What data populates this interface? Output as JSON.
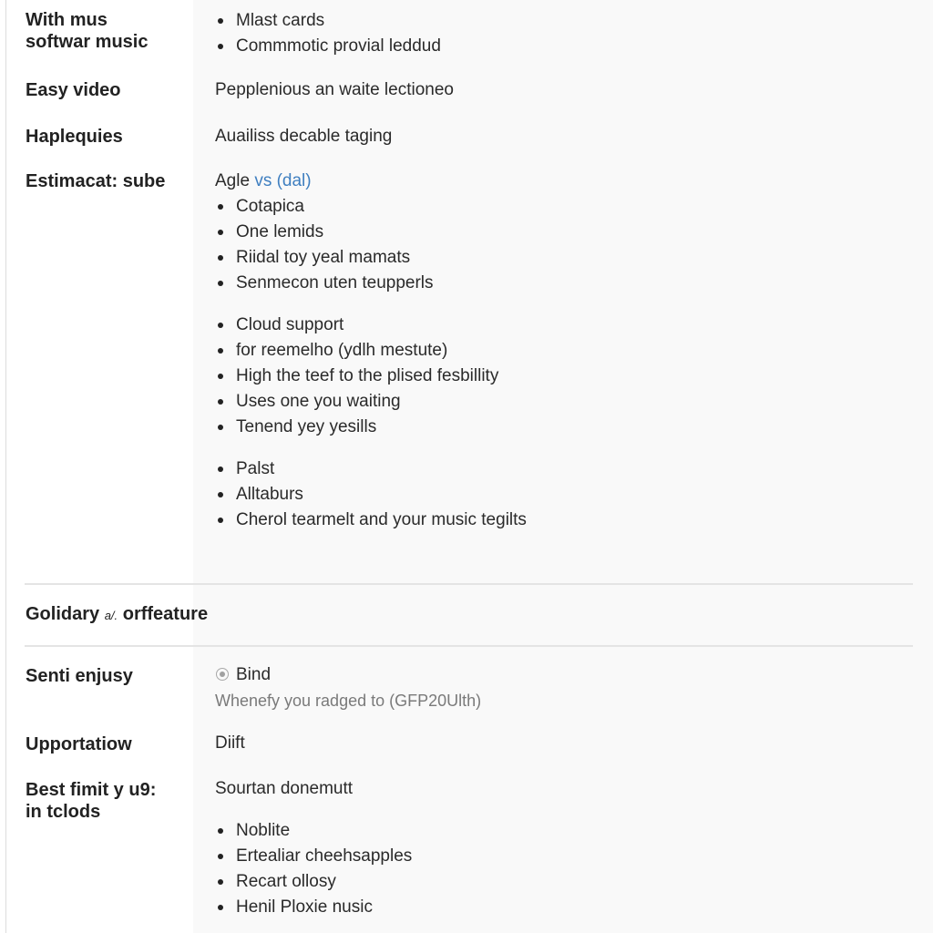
{
  "rows": [
    {
      "label": "With mus softwar music",
      "bullets": [
        "Mlast cards",
        "Commmotic provial leddud"
      ]
    },
    {
      "label": "Easy video",
      "value": "Pepplenious an waite lectioneo"
    },
    {
      "label": "Haplequies",
      "value": "Auailiss decable taging"
    },
    {
      "label": "Estimacat: sube",
      "value_prefix": "Agle",
      "value_link": "vs (dal)",
      "bullets": [
        "Cotapica",
        "One lemids",
        "Riidal toy yeal mamats",
        "Senmecon uten teupperls"
      ],
      "bullets2": [
        "Cloud support",
        "for reemelho (ydlh mestute)",
        "High the teef to the plised fesbillity",
        "Uses one you waiting",
        "Tenend yey yesills"
      ],
      "bullets3": [
        "Palst",
        "Alltaburs",
        "Cherol tearmelt and your music tegilts"
      ]
    }
  ],
  "section": {
    "title_main": "Golidary",
    "title_small": "a/.",
    "title_end": "orffeature"
  },
  "rows2": [
    {
      "label": "Senti enjusy",
      "radio_label": "Bind",
      "hint": "Whenefy you radged to (GFP20Ulth)"
    },
    {
      "label": "Upportatiow",
      "value": "Diift"
    },
    {
      "label": "Best fimit y u9: in tclods",
      "value": "Sourtan donemutt",
      "bullets": [
        "Noblite",
        "Ertealiar cheehsapples",
        "Recart ollosy",
        "Henil Ploxie nusic"
      ]
    }
  ],
  "colors": {
    "link": "#3f7fc0",
    "divider": "#e4e4e4",
    "value_bg": "#f9f9f9"
  }
}
